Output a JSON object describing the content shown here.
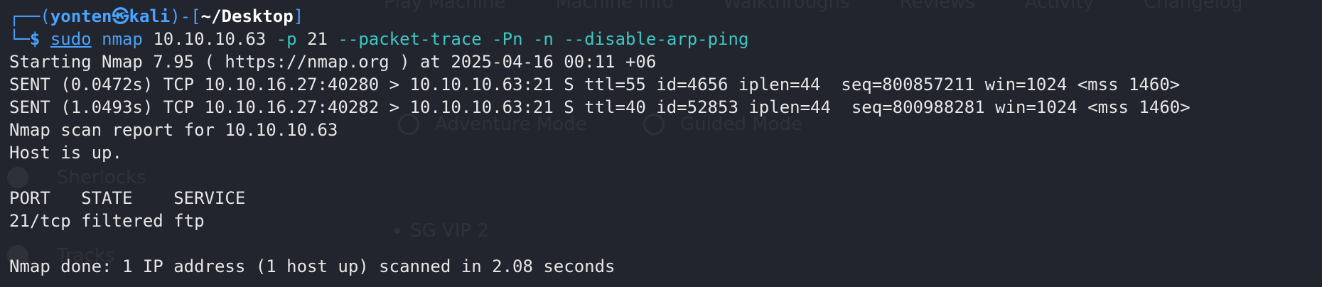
{
  "background": {
    "nav": [
      "Play Machine",
      "Machine Info",
      "Walkthroughs",
      "Reviews",
      "Activity",
      "Changelog"
    ],
    "modes": [
      "Adventure Mode",
      "Guided Mode"
    ],
    "sidebar": [
      "Sherlocks",
      "Tracks"
    ],
    "vip": "SG VIP 2"
  },
  "prompt": {
    "corner_top": "┌──(",
    "user": "yonten",
    "at_symbol": "㉿",
    "host": "kali",
    "mid": ")-[",
    "path": "~/Desktop",
    "close": "]",
    "corner_bottom": "└─",
    "dollar": "$ ",
    "sudo": "sudo",
    "program": "nmap",
    "target": "10.10.10.63",
    "flag_p": "-p",
    "port": "21",
    "flags": "--packet-trace -Pn -n --disable-arp-ping"
  },
  "output": [
    "Starting Nmap 7.95 ( https://nmap.org ) at 2025-04-16 00:11 +06",
    "SENT (0.0472s) TCP 10.10.16.27:40280 > 10.10.10.63:21 S ttl=55 id=4656 iplen=44  seq=800857211 win=1024 <mss 1460>",
    "SENT (1.0493s) TCP 10.10.16.27:40282 > 10.10.10.63:21 S ttl=40 id=52853 iplen=44  seq=800988281 win=1024 <mss 1460>",
    "Nmap scan report for 10.10.10.63",
    "Host is up.",
    "",
    "PORT   STATE    SERVICE",
    "21/tcp filtered ftp",
    "",
    "Nmap done: 1 IP address (1 host up) scanned in 2.08 seconds"
  ],
  "colors": {
    "background": "#22252d",
    "prompt_blue": "#4aa3ff",
    "option_cyan": "#3fc7c2",
    "text": "#e6e6e6"
  }
}
